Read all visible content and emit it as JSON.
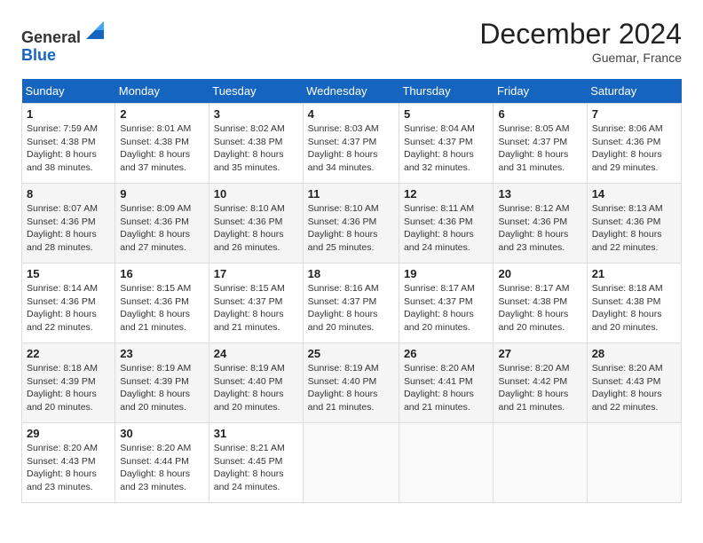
{
  "header": {
    "logo_line1": "General",
    "logo_line2": "Blue",
    "month": "December 2024",
    "location": "Guemar, France"
  },
  "days_of_week": [
    "Sunday",
    "Monday",
    "Tuesday",
    "Wednesday",
    "Thursday",
    "Friday",
    "Saturday"
  ],
  "weeks": [
    [
      {
        "day": "1",
        "sunrise": "7:59 AM",
        "sunset": "4:38 PM",
        "daylight": "8 hours and 38 minutes."
      },
      {
        "day": "2",
        "sunrise": "8:01 AM",
        "sunset": "4:38 PM",
        "daylight": "8 hours and 37 minutes."
      },
      {
        "day": "3",
        "sunrise": "8:02 AM",
        "sunset": "4:38 PM",
        "daylight": "8 hours and 35 minutes."
      },
      {
        "day": "4",
        "sunrise": "8:03 AM",
        "sunset": "4:37 PM",
        "daylight": "8 hours and 34 minutes."
      },
      {
        "day": "5",
        "sunrise": "8:04 AM",
        "sunset": "4:37 PM",
        "daylight": "8 hours and 32 minutes."
      },
      {
        "day": "6",
        "sunrise": "8:05 AM",
        "sunset": "4:37 PM",
        "daylight": "8 hours and 31 minutes."
      },
      {
        "day": "7",
        "sunrise": "8:06 AM",
        "sunset": "4:36 PM",
        "daylight": "8 hours and 29 minutes."
      }
    ],
    [
      {
        "day": "8",
        "sunrise": "8:07 AM",
        "sunset": "4:36 PM",
        "daylight": "8 hours and 28 minutes."
      },
      {
        "day": "9",
        "sunrise": "8:09 AM",
        "sunset": "4:36 PM",
        "daylight": "8 hours and 27 minutes."
      },
      {
        "day": "10",
        "sunrise": "8:10 AM",
        "sunset": "4:36 PM",
        "daylight": "8 hours and 26 minutes."
      },
      {
        "day": "11",
        "sunrise": "8:10 AM",
        "sunset": "4:36 PM",
        "daylight": "8 hours and 25 minutes."
      },
      {
        "day": "12",
        "sunrise": "8:11 AM",
        "sunset": "4:36 PM",
        "daylight": "8 hours and 24 minutes."
      },
      {
        "day": "13",
        "sunrise": "8:12 AM",
        "sunset": "4:36 PM",
        "daylight": "8 hours and 23 minutes."
      },
      {
        "day": "14",
        "sunrise": "8:13 AM",
        "sunset": "4:36 PM",
        "daylight": "8 hours and 22 minutes."
      }
    ],
    [
      {
        "day": "15",
        "sunrise": "8:14 AM",
        "sunset": "4:36 PM",
        "daylight": "8 hours and 22 minutes."
      },
      {
        "day": "16",
        "sunrise": "8:15 AM",
        "sunset": "4:36 PM",
        "daylight": "8 hours and 21 minutes."
      },
      {
        "day": "17",
        "sunrise": "8:15 AM",
        "sunset": "4:37 PM",
        "daylight": "8 hours and 21 minutes."
      },
      {
        "day": "18",
        "sunrise": "8:16 AM",
        "sunset": "4:37 PM",
        "daylight": "8 hours and 20 minutes."
      },
      {
        "day": "19",
        "sunrise": "8:17 AM",
        "sunset": "4:37 PM",
        "daylight": "8 hours and 20 minutes."
      },
      {
        "day": "20",
        "sunrise": "8:17 AM",
        "sunset": "4:38 PM",
        "daylight": "8 hours and 20 minutes."
      },
      {
        "day": "21",
        "sunrise": "8:18 AM",
        "sunset": "4:38 PM",
        "daylight": "8 hours and 20 minutes."
      }
    ],
    [
      {
        "day": "22",
        "sunrise": "8:18 AM",
        "sunset": "4:39 PM",
        "daylight": "8 hours and 20 minutes."
      },
      {
        "day": "23",
        "sunrise": "8:19 AM",
        "sunset": "4:39 PM",
        "daylight": "8 hours and 20 minutes."
      },
      {
        "day": "24",
        "sunrise": "8:19 AM",
        "sunset": "4:40 PM",
        "daylight": "8 hours and 20 minutes."
      },
      {
        "day": "25",
        "sunrise": "8:19 AM",
        "sunset": "4:40 PM",
        "daylight": "8 hours and 21 minutes."
      },
      {
        "day": "26",
        "sunrise": "8:20 AM",
        "sunset": "4:41 PM",
        "daylight": "8 hours and 21 minutes."
      },
      {
        "day": "27",
        "sunrise": "8:20 AM",
        "sunset": "4:42 PM",
        "daylight": "8 hours and 21 minutes."
      },
      {
        "day": "28",
        "sunrise": "8:20 AM",
        "sunset": "4:43 PM",
        "daylight": "8 hours and 22 minutes."
      }
    ],
    [
      {
        "day": "29",
        "sunrise": "8:20 AM",
        "sunset": "4:43 PM",
        "daylight": "8 hours and 23 minutes."
      },
      {
        "day": "30",
        "sunrise": "8:20 AM",
        "sunset": "4:44 PM",
        "daylight": "8 hours and 23 minutes."
      },
      {
        "day": "31",
        "sunrise": "8:21 AM",
        "sunset": "4:45 PM",
        "daylight": "8 hours and 24 minutes."
      },
      null,
      null,
      null,
      null
    ]
  ],
  "labels": {
    "sunrise": "Sunrise:",
    "sunset": "Sunset:",
    "daylight": "Daylight:"
  }
}
